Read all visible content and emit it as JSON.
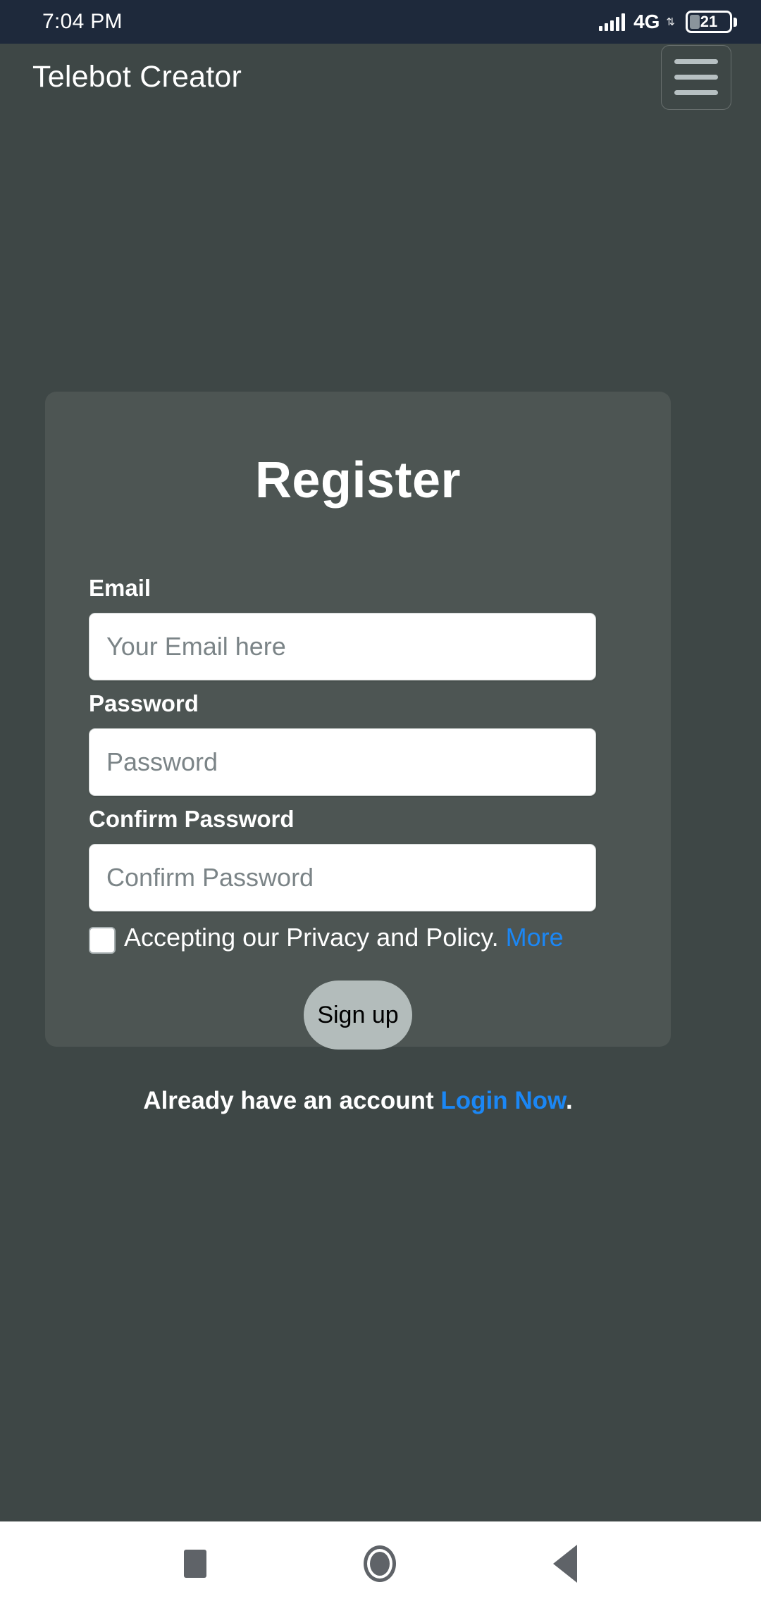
{
  "status_bar": {
    "time": "7:04 PM",
    "network_label": "4G",
    "network_arrows": "⇅",
    "battery_percent": "21",
    "signal_icon": "signal-bars-icon"
  },
  "header": {
    "brand": "Telebot Creator",
    "menu_icon": "hamburger-menu-icon"
  },
  "card": {
    "title": "Register",
    "fields": {
      "email": {
        "label": "Email",
        "placeholder": "Your Email here",
        "value": ""
      },
      "password": {
        "label": "Password",
        "placeholder": "Password",
        "value": ""
      },
      "confirm_password": {
        "label": "Confirm Password",
        "placeholder": "Confirm Password",
        "value": ""
      }
    },
    "terms": {
      "checked": false,
      "text": "Accepting our Privacy and Policy.",
      "link_label": "More"
    },
    "submit_label": "Sign up",
    "footer": {
      "text": "Already have an account",
      "link_label": "Login Now",
      "period": "."
    }
  },
  "nav_bar": {
    "recents_icon": "square-recents-icon",
    "home_icon": "circle-home-icon",
    "back_icon": "triangle-back-icon"
  },
  "colors": {
    "page_background": "#3e4746",
    "card_background": "#4d5553",
    "status_bar_background": "#1e293b",
    "link_blue": "#1b87f5",
    "button_gray": "#b3bcbb",
    "nav_bar_background": "#ffffff"
  }
}
